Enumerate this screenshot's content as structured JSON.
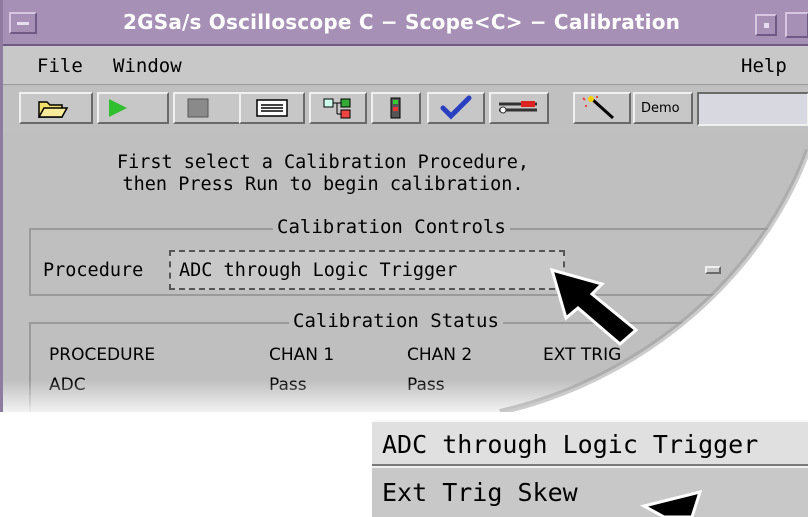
{
  "window": {
    "title": "2GSa/s Oscilloscope C − Scope<C> − Calibration"
  },
  "menubar": {
    "file": "File",
    "window": "Window",
    "help": "Help"
  },
  "toolbar": {
    "demo_label": "Demo",
    "icons": [
      "open-folder-icon",
      "play-icon",
      "stop-icon",
      "list-icon",
      "network-icon",
      "module-icon",
      "checkmark-icon",
      "wrench-icon",
      "magic-wand-icon"
    ]
  },
  "instructions": {
    "line1": "First select a Calibration Procedure,",
    "line2": "then Press Run to begin calibration."
  },
  "controls": {
    "group_label": "Calibration Controls",
    "procedure_label": "Procedure",
    "procedure_value": "ADC through Logic Trigger"
  },
  "status": {
    "group_label": "Calibration Status",
    "columns": [
      "PROCEDURE",
      "CHAN 1",
      "CHAN 2",
      "EXT TRIG"
    ],
    "rows": [
      [
        "ADC",
        "Pass",
        "Pass",
        ""
      ]
    ]
  },
  "popup_menu": {
    "items": [
      "ADC through Logic Trigger",
      "Ext Trig Skew"
    ]
  },
  "colors": {
    "titlebar": "#a790b6",
    "window_bg": "#bfbfbf"
  }
}
